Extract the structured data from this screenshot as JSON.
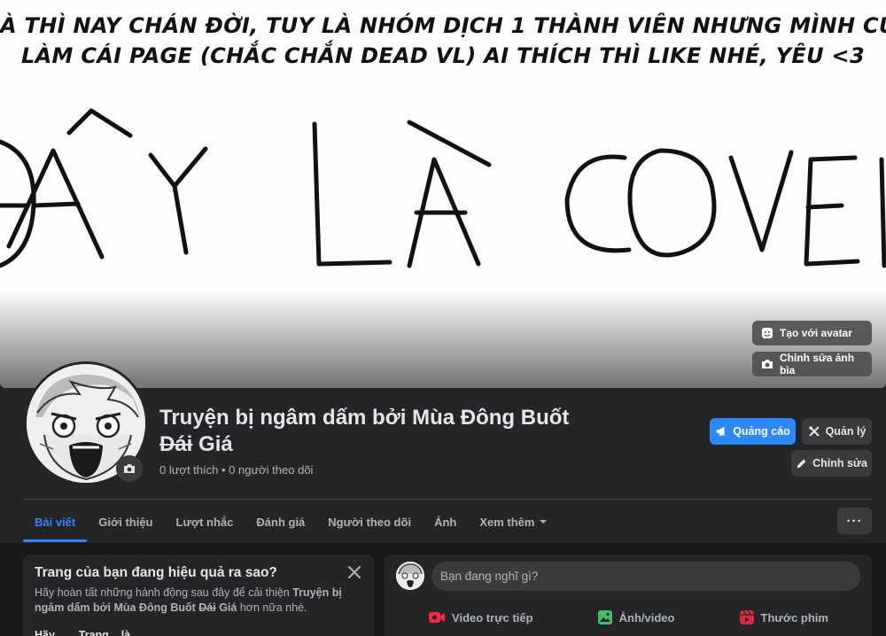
{
  "cover": {
    "caption_line1": "À THÌ NAY CHÁN ĐỜI, TUY LÀ NHÓM DỊCH 1 THÀNH VIÊN NHƯNG MÌNH CỨ",
    "caption_line2": "LÀM CÁI PAGE (CHẮC CHẮN DEAD VL) AI THÍCH THÌ LIKE NHÉ, YÊU <3",
    "art_text": "ĐÂY LÀ COVER",
    "btn_avatar": "Tạo với avatar",
    "btn_edit_cover": "Chỉnh sửa ảnh bìa"
  },
  "page": {
    "name_part1": "Truyện bị ngâm dấm bởi Mùa Đông Buốt",
    "name_part2": "Dái",
    "name_part3": " Giá",
    "stats": "0 lượt thích • 0 người theo dõi"
  },
  "actions": {
    "ads": "Quảng cáo",
    "manage": "Quản lý",
    "edit": "Chỉnh sửa",
    "more": "···"
  },
  "tabs": [
    {
      "label": "Bài viết"
    },
    {
      "label": "Giới thiệu"
    },
    {
      "label": "Lượt nhắc"
    },
    {
      "label": "Đánh giá"
    },
    {
      "label": "Người theo dõi"
    },
    {
      "label": "Ảnh"
    },
    {
      "label": "Xem thêm"
    }
  ],
  "tips_card": {
    "title": "Trang của bạn đang hiệu quả ra sao?",
    "desc_part1": "Hãy hoàn tất những hành động sau đây để cải thiện ",
    "desc_name1": "Truyện bị ngâm dấm bởi Mùa Đông Buốt",
    "desc_name2": "Dái",
    "desc_name3": " Giá",
    "desc_part2": " hơn nữa nhé.",
    "partial_line": "Hãy... ... Trang... là..."
  },
  "composer": {
    "placeholder": "Bạn đang nghĩ gì?",
    "live": "Video trực tiếp",
    "photo": "Ảnh/video",
    "reel": "Thước phim"
  },
  "colors": {
    "accent": "#2d88ff",
    "page_bg": "#18191a",
    "card_bg": "#242526",
    "live_red": "#f02849",
    "photo_green": "#45bd62",
    "reel_pink": "#e42645"
  }
}
